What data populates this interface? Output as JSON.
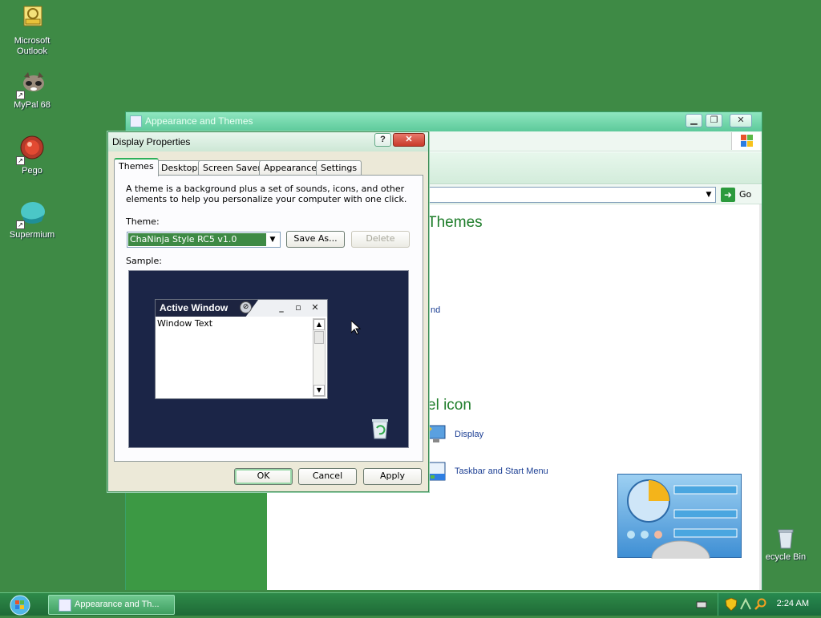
{
  "desktop": {
    "icons": [
      {
        "label": "Microsoft\nOutlook"
      },
      {
        "label": "MyPal 68"
      },
      {
        "label": "Pego"
      },
      {
        "label": "Supermium"
      },
      {
        "label": "ecycle Bin"
      }
    ]
  },
  "back_window": {
    "title": "Appearance and Themes",
    "address_go": "Go",
    "heading_themes": "Themes",
    "link_partial": "nd",
    "heading_icon": "el icon",
    "link_display": "Display",
    "link_taskbar": "Taskbar and Start Menu"
  },
  "dialog": {
    "title": "Display Properties",
    "help_label": "?",
    "close_label": "✕",
    "tabs": [
      "Themes",
      "Desktop",
      "Screen Saver",
      "Appearance",
      "Settings"
    ],
    "description": "A theme is a background plus a set of sounds, icons, and other elements to help you personalize your computer with one click.",
    "theme_label": "Theme:",
    "theme_value": "ChaNinja Style RC5 v1.0",
    "save_as": "Save As...",
    "delete": "Delete",
    "sample_label": "Sample:",
    "sample": {
      "window_title": "Active Window",
      "window_text": "Window Text"
    },
    "ok": "OK",
    "cancel": "Cancel",
    "apply": "Apply"
  },
  "taskbar": {
    "task_label": "Appearance and Th...",
    "clock": "2:24 AM"
  },
  "colors": {
    "desktop": "#3e8a45",
    "accent": "#2fb05a"
  }
}
